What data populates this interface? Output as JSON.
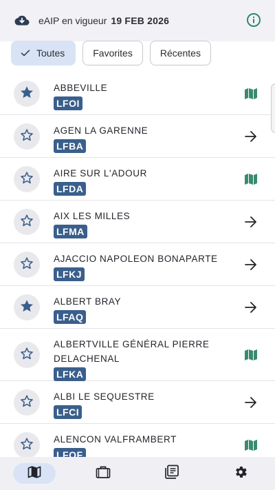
{
  "header": {
    "status_label": "eAIP en vigueur",
    "status_date": "19 FEB 2026",
    "cloud_icon": "cloud-download-icon",
    "info_icon": "info-icon"
  },
  "filters": [
    {
      "label": "Toutes",
      "selected": true
    },
    {
      "label": "Favorites",
      "selected": false
    },
    {
      "label": "Récentes",
      "selected": false
    }
  ],
  "airports": [
    {
      "name": "ABBEVILLE",
      "code": "LFOI",
      "favorite": true,
      "trail": "map-icon"
    },
    {
      "name": "AGEN LA GARENNE",
      "code": "LFBA",
      "favorite": false,
      "trail": "arrow-right-icon"
    },
    {
      "name": "AIRE SUR L'ADOUR",
      "code": "LFDA",
      "favorite": false,
      "trail": "map-icon"
    },
    {
      "name": "AIX LES MILLES",
      "code": "LFMA",
      "favorite": false,
      "trail": "arrow-right-icon"
    },
    {
      "name": "AJACCIO NAPOLEON BONAPARTE",
      "code": "LFKJ",
      "favorite": false,
      "trail": "arrow-right-icon"
    },
    {
      "name": "ALBERT BRAY",
      "code": "LFAQ",
      "favorite": true,
      "trail": "arrow-right-icon"
    },
    {
      "name": "ALBERTVILLE GÉNÉRAL PIERRE DELACHENAL",
      "code": "LFKA",
      "favorite": false,
      "trail": "map-icon"
    },
    {
      "name": "ALBI LE SEQUESTRE",
      "code": "LFCI",
      "favorite": false,
      "trail": "arrow-right-icon"
    },
    {
      "name": "ALENCON VALFRAMBERT",
      "code": "LFOF",
      "favorite": false,
      "trail": "map-icon"
    }
  ],
  "nav": [
    {
      "icon": "map-icon",
      "active": true
    },
    {
      "icon": "briefcase-icon",
      "active": false
    },
    {
      "icon": "documents-icon",
      "active": false
    },
    {
      "icon": "settings-icon",
      "active": false
    }
  ],
  "colors": {
    "accent": "#3a5f8c",
    "map_green": "#3a8a70",
    "chip_selected": "#d8e4f5",
    "info_green": "#2e8a66"
  }
}
